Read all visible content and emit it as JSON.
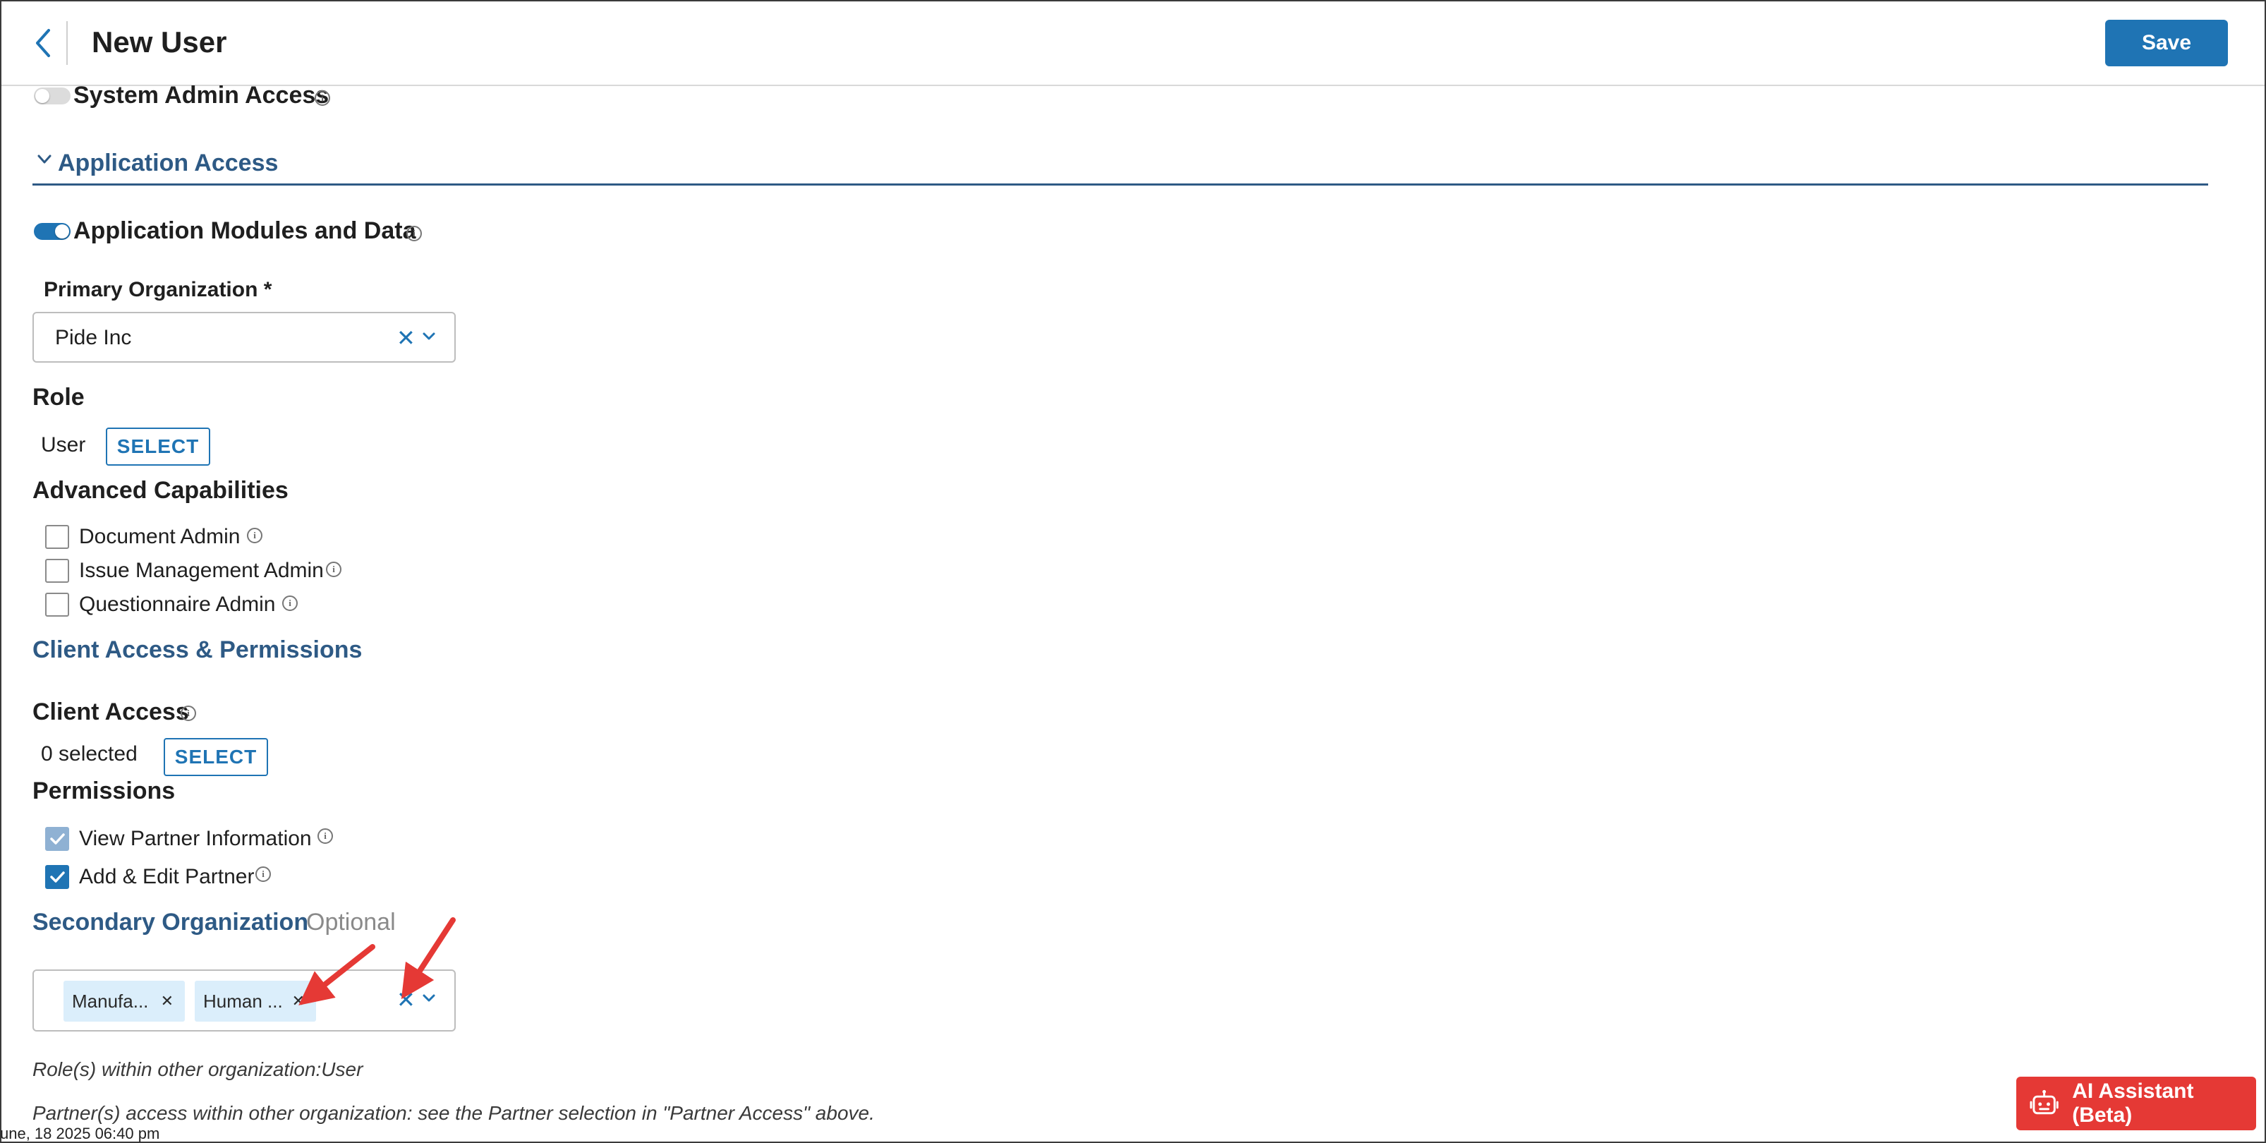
{
  "header": {
    "title": "New User",
    "save_label": "Save"
  },
  "system_admin": {
    "label": "System Admin Access",
    "enabled": false
  },
  "application_access": {
    "heading": "Application Access",
    "modules_label": "Application Modules and Data",
    "modules_enabled": true
  },
  "primary_org": {
    "label": "Primary Organization *",
    "value": "Pide Inc"
  },
  "role": {
    "heading": "Role",
    "value": "User",
    "select_label": "SELECT"
  },
  "advanced": {
    "heading": "Advanced Capabilities",
    "items": [
      {
        "label": "Document Admin",
        "checked": false
      },
      {
        "label": "Issue Management Admin",
        "checked": false
      },
      {
        "label": "Questionnaire Admin",
        "checked": false
      }
    ]
  },
  "client_section": {
    "heading": "Client Access & Permissions"
  },
  "client_access": {
    "heading": "Client Access",
    "count": "0 selected",
    "select_label": "SELECT"
  },
  "permissions": {
    "heading": "Permissions",
    "items": [
      {
        "label": "View Partner Information",
        "checked": true,
        "disabled": true
      },
      {
        "label": "Add & Edit Partner",
        "checked": true,
        "disabled": false
      }
    ]
  },
  "secondary_org": {
    "heading": "Secondary Organization",
    "optional": "Optional",
    "chips": [
      "Manufa...",
      "Human ..."
    ]
  },
  "notes": {
    "roles": "Role(s) within other organization:User",
    "partners": "Partner(s) access within other organization: see the Partner selection in \"Partner Access\" above."
  },
  "ai_assistant": {
    "label": "AI Assistant (Beta)"
  },
  "timestamp": "une, 18 2025 06:40 pm",
  "colors": {
    "primary": "#1f74b4",
    "section": "#2e5a85",
    "annotation": "#e53935"
  }
}
